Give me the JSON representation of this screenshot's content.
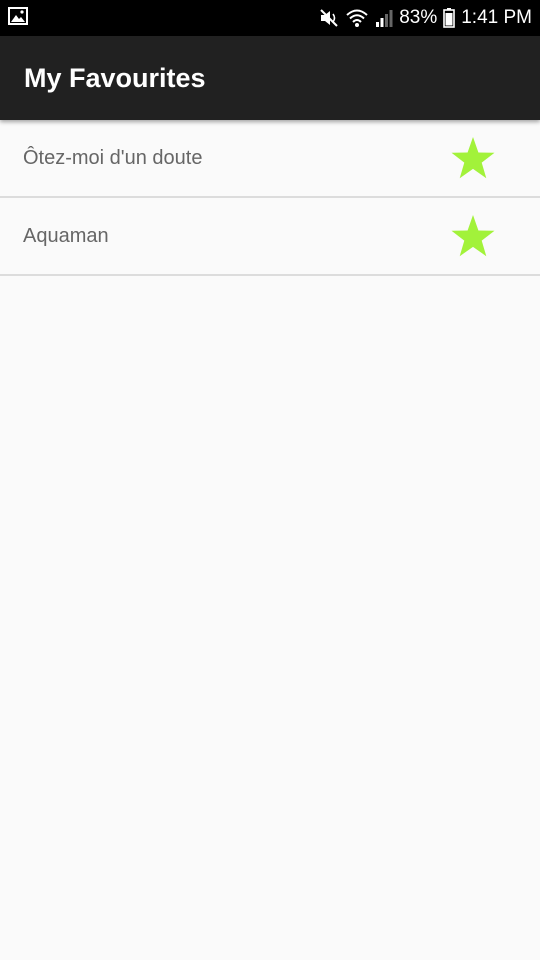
{
  "status_bar": {
    "battery": "83%",
    "time": "1:41 PM",
    "icons": [
      "image-icon",
      "mute-icon",
      "wifi-icon",
      "signal-icon",
      "battery-icon"
    ]
  },
  "app_bar": {
    "title": "My Favourites"
  },
  "favourites": {
    "items": [
      {
        "label": "Ôtez-moi d'un doute",
        "icon": "star-icon"
      },
      {
        "label": "Aquaman",
        "icon": "star-icon"
      }
    ]
  },
  "colors": {
    "app_bar": "#212121",
    "status_bar": "#000000",
    "star": "#a2f23a",
    "background": "#fafafa",
    "item_text": "#666666",
    "divider": "#dcdcdc"
  }
}
